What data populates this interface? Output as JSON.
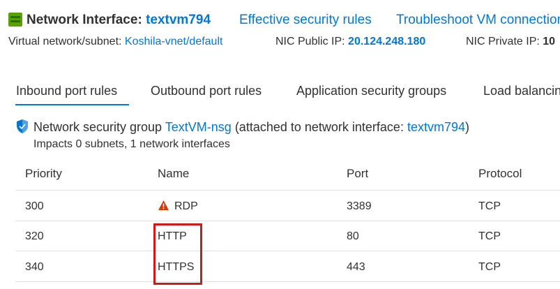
{
  "header": {
    "title_label": "Network Interface:",
    "title_value": "textvm794",
    "links": [
      "Effective security rules",
      "Troubleshoot VM connection"
    ]
  },
  "info": {
    "vnet_label": "Virtual network/subnet:",
    "vnet_value": "Koshila-vnet/default",
    "public_ip_label": "NIC Public IP:",
    "public_ip_value": "20.124.248.180",
    "private_ip_label": "NIC Private IP:",
    "private_ip_value": "10"
  },
  "tabs": [
    {
      "label": "Inbound port rules",
      "active": true
    },
    {
      "label": "Outbound port rules",
      "active": false
    },
    {
      "label": "Application security groups",
      "active": false
    },
    {
      "label": "Load balancing",
      "active": false
    }
  ],
  "nsg": {
    "prefix": "Network security group",
    "name": "TextVM-nsg",
    "attached_prefix": "(attached to network interface:",
    "attached_nic": "textvm794",
    "attached_suffix": ")",
    "impacts": "Impacts 0 subnets, 1 network interfaces"
  },
  "table": {
    "columns": [
      "Priority",
      "Name",
      "Port",
      "Protocol"
    ],
    "rows": [
      {
        "priority": "300",
        "name": "RDP",
        "port": "3389",
        "protocol": "TCP",
        "warning": true
      },
      {
        "priority": "320",
        "name": "HTTP",
        "port": "80",
        "protocol": "TCP",
        "warning": false
      },
      {
        "priority": "340",
        "name": "HTTPS",
        "port": "443",
        "protocol": "TCP",
        "warning": false
      }
    ]
  },
  "icons": {
    "nic": "network-interface-icon",
    "shield": "shield-icon",
    "warning": "warning-icon"
  },
  "colors": {
    "link": "#0078d4",
    "highlight": "#d01a1a",
    "warning": "#d83b01"
  }
}
